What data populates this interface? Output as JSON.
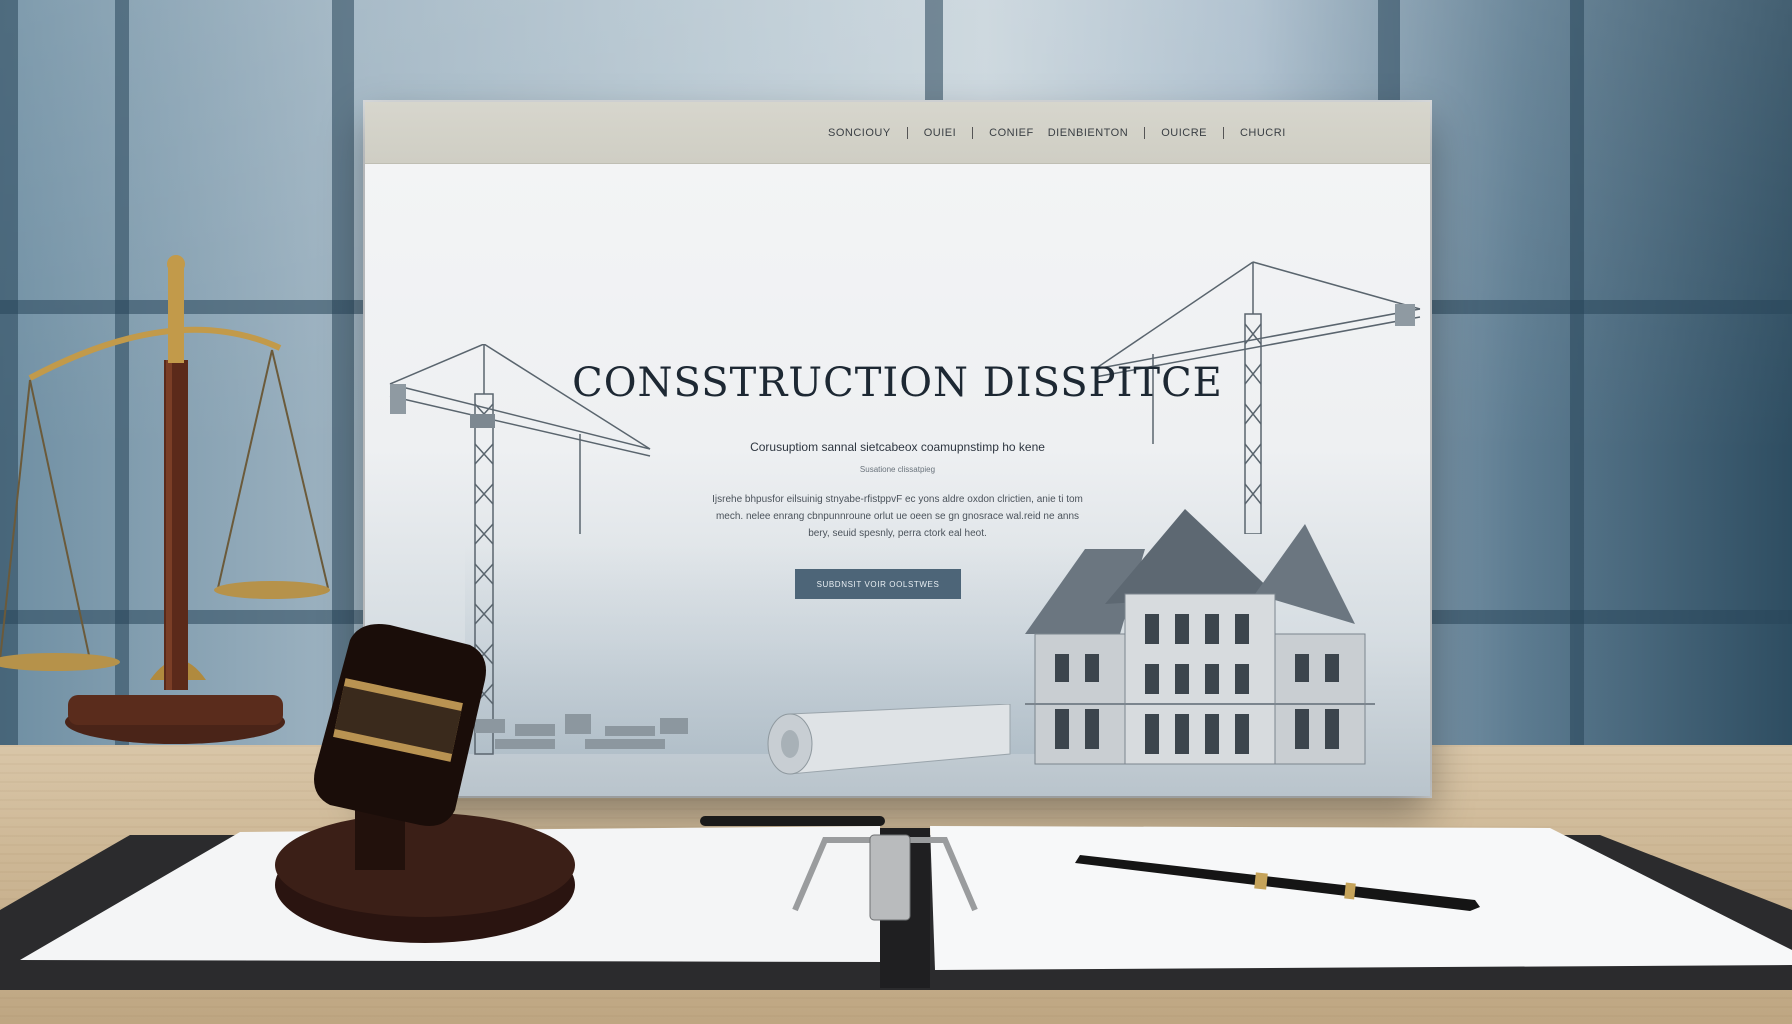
{
  "nav": {
    "items": [
      "SONCIOUY",
      "OUIEI",
      "CONIEF",
      "DIENBIENTON",
      "OUICRE",
      "CHUCRI"
    ]
  },
  "hero": {
    "title": "CONSSTRUCTION DISSPITCE",
    "subtitle": "Corusuptiom sannal sietcabeox coamupnstimp ho kene",
    "tagline": "Susatione clissatpieg",
    "body": "Ijsrehe bhpusfor eilsuinig stnyabe-rfistppvF ec yons aldre oxdon clrictien, anie ti tom mech. nelee enrang cbnpunnroune orlut ue oeen se gn gnosrace wal.reid ne anns bery, seuid spesnly, perra ctork eal heot.",
    "cta_label": "SUBDNSIT VOIR OOLSTWES"
  },
  "icons": [
    "crane-left-illustration",
    "crane-right-illustration",
    "house-illustration",
    "blueprint-roll",
    "scales-of-justice",
    "gavel",
    "pen",
    "clipboard"
  ],
  "colors": {
    "cta": "#4d6578",
    "nav_bg": "#d7d6cd",
    "title": "#1d2833"
  }
}
